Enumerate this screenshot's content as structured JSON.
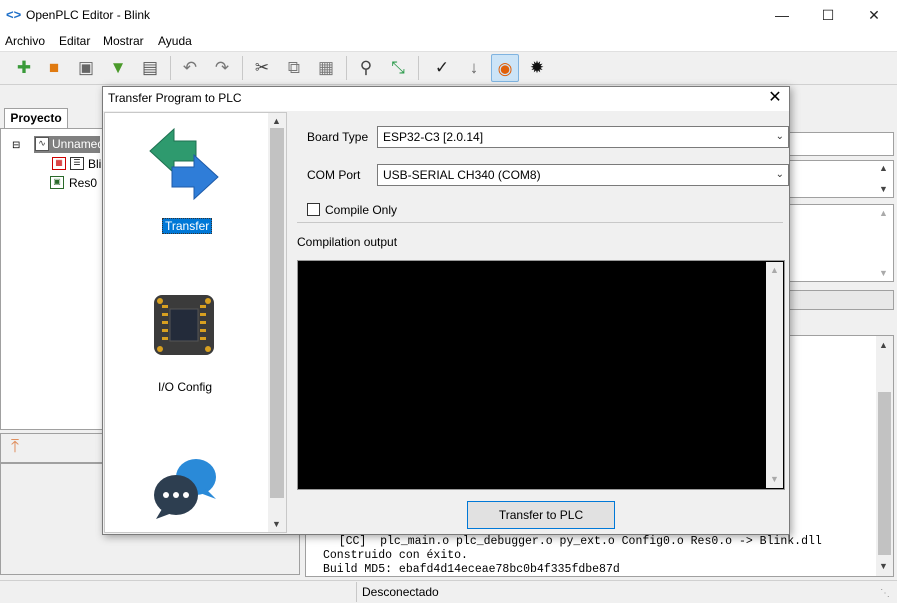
{
  "window": {
    "title": "OpenPLC Editor - Blink",
    "icon": "code-brackets-icon"
  },
  "menu": [
    "Archivo",
    "Editar",
    "Mostrar",
    "Ayuda"
  ],
  "toolbar": {
    "icons": [
      "new-file-icon",
      "open-folder-icon",
      "save-icon",
      "save-as-icon",
      "print-icon",
      "undo-icon",
      "redo-icon",
      "cut-icon",
      "copy-icon",
      "paste-icon",
      "find-icon",
      "fullscreen-icon",
      "run-icon",
      "download-icon",
      "transfer-plc-icon",
      "debug-icon"
    ]
  },
  "project": {
    "tab_label": "Proyecto",
    "tree": [
      "Unnamed",
      "Bli",
      "Res0"
    ]
  },
  "console": {
    "lines": [
      "   [CC]  plc_main.o plc_debugger.o py_ext.o Config0.o Res0.o -> Blink.dll",
      "Construido con éxito.",
      "Build MD5: ebafd4d14eceae78bc0b4f335fdbe87d"
    ]
  },
  "status": {
    "connection": "Desconectado"
  },
  "dialog": {
    "title": "Transfer Program to PLC",
    "side_items": [
      {
        "label": "Transfer",
        "icon": "transfer-arrows-icon",
        "selected": true
      },
      {
        "label": "I/O Config",
        "icon": "chip-icon",
        "selected": false
      },
      {
        "label": "",
        "icon": "chat-bubbles-icon",
        "selected": false
      }
    ],
    "board_type_label": "Board Type",
    "board_type_value": "ESP32-C3 [2.0.14]",
    "com_port_label": "COM Port",
    "com_port_value": "USB-SERIAL CH340 (COM8)",
    "compile_only_label": "Compile Only",
    "compile_only_checked": false,
    "output_label": "Compilation output",
    "transfer_button": "Transfer to PLC"
  },
  "colors": {
    "accent": "#0078d7",
    "output_bg": "#000000"
  }
}
